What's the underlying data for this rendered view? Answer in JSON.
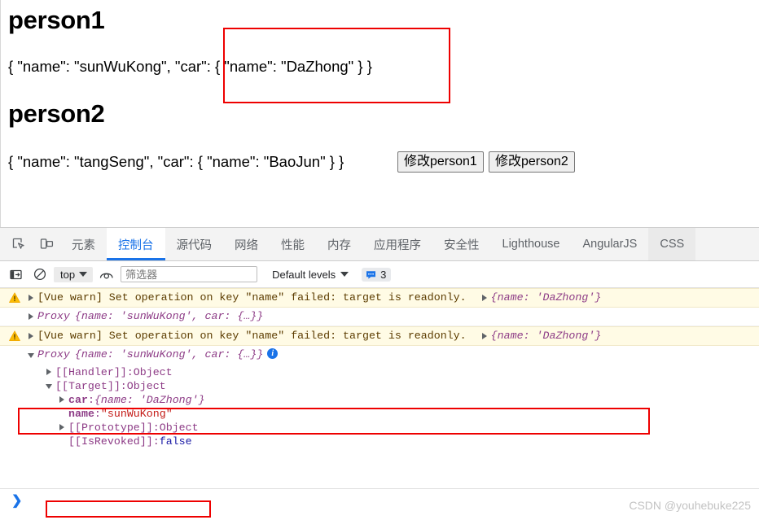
{
  "page": {
    "heading1": "person1",
    "json1": "{ \"name\": \"sunWuKong\", \"car\": { \"name\": \"DaZhong\" } }",
    "heading2": "person2",
    "json2": "{ \"name\": \"tangSeng\", \"car\": { \"name\": \"BaoJun\" } }",
    "button1": "修改person1",
    "button2": "修改person2",
    "annotation_color": "#ee0000"
  },
  "devtools": {
    "tabs": [
      {
        "label": "元素",
        "state": "normal"
      },
      {
        "label": "控制台",
        "state": "selected"
      },
      {
        "label": "源代码",
        "state": "normal"
      },
      {
        "label": "网络",
        "state": "normal"
      },
      {
        "label": "性能",
        "state": "normal"
      },
      {
        "label": "内存",
        "state": "normal"
      },
      {
        "label": "应用程序",
        "state": "normal"
      },
      {
        "label": "安全性",
        "state": "normal"
      },
      {
        "label": "Lighthouse",
        "state": "normal"
      },
      {
        "label": "AngularJS",
        "state": "normal"
      },
      {
        "label": "CSS",
        "state": "hovered"
      }
    ],
    "icons": {
      "inspect": "inspect-element-icon",
      "device": "device-toolbar-icon",
      "sidebar": "console-sidebar-icon",
      "clear": "clear-console-icon",
      "eye": "live-expression-icon",
      "message_badge": "message-bubble-icon"
    },
    "toolbar": {
      "context": "top",
      "filter_placeholder": "筛选器",
      "filter_value": "",
      "levels": "Default levels",
      "message_count": "3"
    },
    "accent_color": "#1a73e8",
    "warn_bg": "#fffbe5"
  },
  "console": {
    "messages": [
      {
        "type": "warning",
        "text": "[Vue warn] Set operation on key \"name\" failed: target is readonly.",
        "object": "{name: 'DaZhong'}",
        "highlighted": false
      },
      {
        "type": "log",
        "prefix": "Proxy",
        "preview": "{name: 'sunWuKong', car: {…}}",
        "expanded": false
      },
      {
        "type": "warning",
        "text": "[Vue warn] Set operation on key \"name\" failed: target is readonly.",
        "object": "{name: 'DaZhong'}",
        "highlighted": true
      },
      {
        "type": "log",
        "prefix": "Proxy",
        "preview": "{name: 'sunWuKong', car: {…}}",
        "expanded": true
      }
    ],
    "tree": [
      {
        "indent": 1,
        "arrow": "closed",
        "key": "[[Handler]]",
        "sep": ": ",
        "value": "Object",
        "value_kind": "object"
      },
      {
        "indent": 1,
        "arrow": "open",
        "key": "[[Target]]",
        "sep": ": ",
        "value": "Object",
        "value_kind": "object"
      },
      {
        "indent": 2,
        "arrow": "closed",
        "key": "car",
        "sep": ": ",
        "value": "{name: 'DaZhong'}",
        "value_kind": "preview"
      },
      {
        "indent": 2,
        "arrow": "none",
        "key": "name",
        "sep": ": ",
        "value": "\"sunWuKong\"",
        "value_kind": "string"
      },
      {
        "indent": 2,
        "arrow": "closed",
        "key": "[[Prototype]]",
        "sep": ": ",
        "value": "Object",
        "value_kind": "object"
      },
      {
        "indent": 2,
        "arrow": "none",
        "key": "[[IsRevoked]]",
        "sep": ": ",
        "value": "false",
        "value_kind": "bool"
      }
    ],
    "prompt_caret": "❯"
  },
  "watermark": "CSDN @youhebuke225"
}
